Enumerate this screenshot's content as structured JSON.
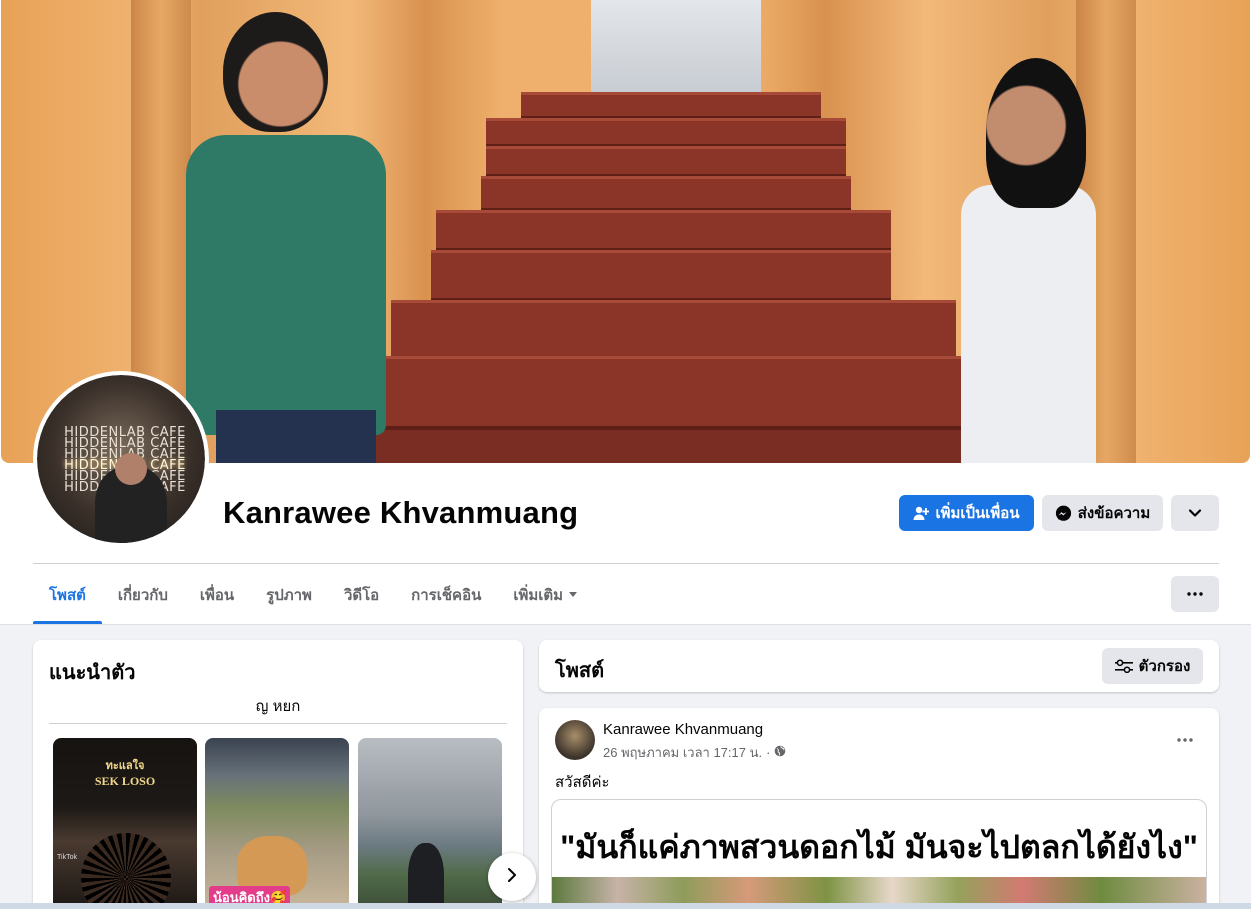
{
  "profile": {
    "name": "Kanrawee Khvanmuang",
    "cover_photo_desc": "cover-photo",
    "avatar_sign_lines": [
      "HIDDENLAB CAFE",
      "HIDDENLAB CAFE",
      "HIDDENLAB CAFE",
      "HIDDENLAB CAFE",
      "HIDDENLAB CAFE",
      "HIDDENLAB CAFE"
    ]
  },
  "actions": {
    "add_friend": "เพิ่มเป็นเพื่อน",
    "message": "ส่งข้อความ",
    "primary_color": "#1b74e4"
  },
  "tabs": [
    {
      "label": "โพสต์",
      "active": true
    },
    {
      "label": "เกี่ยวกับ"
    },
    {
      "label": "เพื่อน"
    },
    {
      "label": "รูปภาพ"
    },
    {
      "label": "วิดีโอ"
    },
    {
      "label": "การเช็คอิน"
    },
    {
      "label": "เพิ่มเติม"
    }
  ],
  "intro": {
    "title": "แนะนำตัว",
    "bio": "ญ หยก",
    "stories": [
      {
        "title": "ทะแลใจ",
        "subtitle": "SEK LOSO",
        "watermark": "TikTok"
      },
      {
        "caption": "น้อนคิดถึง🥰"
      },
      {}
    ]
  },
  "posts_header": {
    "title": "โพสต์",
    "filter_label": "ตัวกรอง"
  },
  "post": {
    "author": "Kanrawee Khvanmuang",
    "date": "26 พฤษภาคม เวลา 17:17 น.",
    "separator": "·",
    "audience_icon": "globe-icon",
    "text": "สวัสดีค่ะ",
    "quote": "\"มันก็แค่ภาพสวนดอกไม้ มันจะไปตลกได้ยังไง\""
  }
}
